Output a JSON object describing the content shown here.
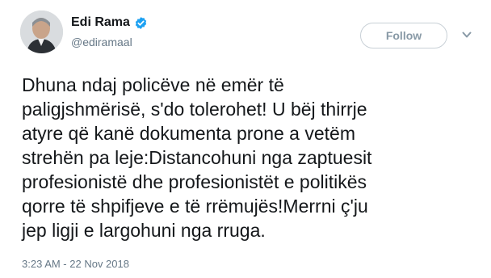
{
  "user": {
    "display_name": "Edi Rama",
    "handle": "@ediramaal"
  },
  "follow_button": {
    "label": "Follow"
  },
  "icons": {
    "verified": "verified-badge-icon",
    "menu": "chevron-down-icon"
  },
  "colors": {
    "verified_blue": "#1da1f2",
    "text": "#14171a",
    "secondary_text": "#657786"
  },
  "tweet": {
    "text": "Dhuna ndaj policëve në emër të\npaligjshmërisë, s'do tolerohet! U bëj thirrje\natyre që kanë dokumenta prone a vetëm\nstrehën pa leje:Distancohuni nga zaptuesit\nprofesionistë dhe profesionistët e politikës\nqorre të shpifjeve e të rrëmujës!Merrni ç'ju\njep ligji e largohuni nga rruga.",
    "timestamp": "3:23 AM - 22 Nov 2018"
  }
}
